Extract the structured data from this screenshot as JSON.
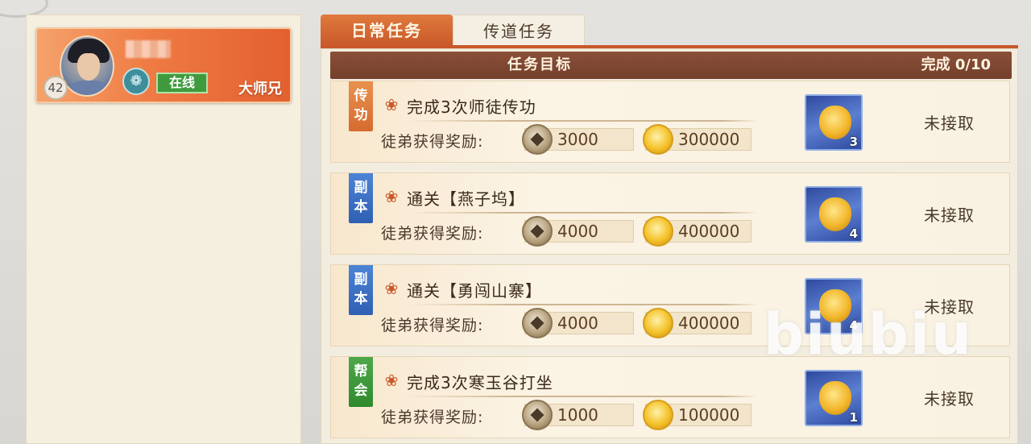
{
  "player": {
    "level": "42",
    "status": "在线",
    "rank": "大师兄",
    "job_icon": "swirl-class-icon"
  },
  "tabs": [
    {
      "label": "日常任务",
      "active": true
    },
    {
      "label": "传道任务",
      "active": false
    }
  ],
  "task_header": {
    "title": "任务目标",
    "progress": "完成 0/10"
  },
  "tasks": [
    {
      "tag": "传功",
      "tag_color": "#d66b2f",
      "title": "完成3次师徒传功",
      "reward_label": "徒弟获得奖励:",
      "copper": "3000",
      "gold": "300000",
      "item_count": "3",
      "status": "未接取"
    },
    {
      "tag": "副本",
      "tag_color": "#2f5fb3",
      "title": "通关【燕子坞】",
      "reward_label": "徒弟获得奖励:",
      "copper": "4000",
      "gold": "400000",
      "item_count": "4",
      "status": "未接取"
    },
    {
      "tag": "副本",
      "tag_color": "#2f5fb3",
      "title": "通关【勇闯山寨】",
      "reward_label": "徒弟获得奖励:",
      "copper": "4000",
      "gold": "400000",
      "item_count": "4",
      "status": "未接取"
    },
    {
      "tag": "帮会",
      "tag_color": "#2f8a2e",
      "title": "完成3次寒玉谷打坐",
      "reward_label": "徒弟获得奖励:",
      "copper": "1000",
      "gold": "100000",
      "item_count": "1",
      "status": "未接取"
    }
  ],
  "watermark": "biubiu"
}
